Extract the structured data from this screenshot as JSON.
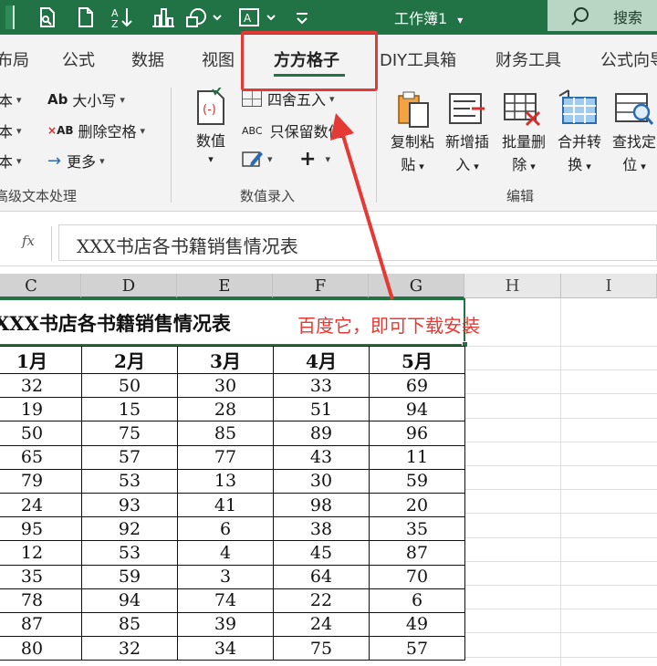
{
  "titlebar": {
    "doc_title": "工作簿1",
    "doc_caret": "⌄",
    "search_label": "搜索"
  },
  "tabs": [
    "布局",
    "公式",
    "数据",
    "视图",
    "方方格子",
    "DIY工具箱",
    "财务工具",
    "公式向导"
  ],
  "active_tab": "方方格子",
  "ribbon": {
    "text_group": {
      "items": [
        "大小写",
        "删除空格",
        "更多"
      ],
      "left_labels": [
        "本",
        "本",
        "本"
      ],
      "label": "高级文本处理"
    },
    "value_group": {
      "value_button": "数值",
      "items": [
        "四舍五入",
        "只保留数值"
      ],
      "label": "数值录入"
    },
    "edit_group": {
      "buttons": [
        {
          "line1": "复制粘",
          "line2": "贴"
        },
        {
          "line1": "新增插",
          "line2": "入"
        },
        {
          "line1": "批量删",
          "line2": "除"
        },
        {
          "line1": "合并转",
          "line2": "换"
        },
        {
          "line1": "查找定",
          "line2": "位"
        }
      ],
      "label": "编辑"
    }
  },
  "formula_bar": {
    "fx": "fx",
    "content": "XXX书店各书籍销售情况表"
  },
  "columns": [
    "C",
    "D",
    "E",
    "F",
    "G",
    "H",
    "I"
  ],
  "sheet": {
    "title": "XXX书店各书籍销售情况表",
    "headers": [
      "1月",
      "2月",
      "3月",
      "4月",
      "5月"
    ],
    "rows": [
      [
        32,
        50,
        30,
        33,
        69
      ],
      [
        19,
        15,
        28,
        51,
        94
      ],
      [
        50,
        75,
        85,
        89,
        96
      ],
      [
        65,
        57,
        77,
        43,
        11
      ],
      [
        79,
        53,
        13,
        30,
        59
      ],
      [
        24,
        93,
        41,
        98,
        20
      ],
      [
        95,
        92,
        6,
        38,
        35
      ],
      [
        12,
        53,
        4,
        45,
        87
      ],
      [
        35,
        59,
        3,
        64,
        70
      ],
      [
        78,
        94,
        74,
        22,
        6
      ],
      [
        87,
        85,
        39,
        24,
        49
      ],
      [
        80,
        32,
        34,
        75,
        57
      ]
    ]
  },
  "annotation": "百度它，即可下载安装",
  "colors": {
    "excel_green": "#217346",
    "annotation_red": "#e53935"
  }
}
